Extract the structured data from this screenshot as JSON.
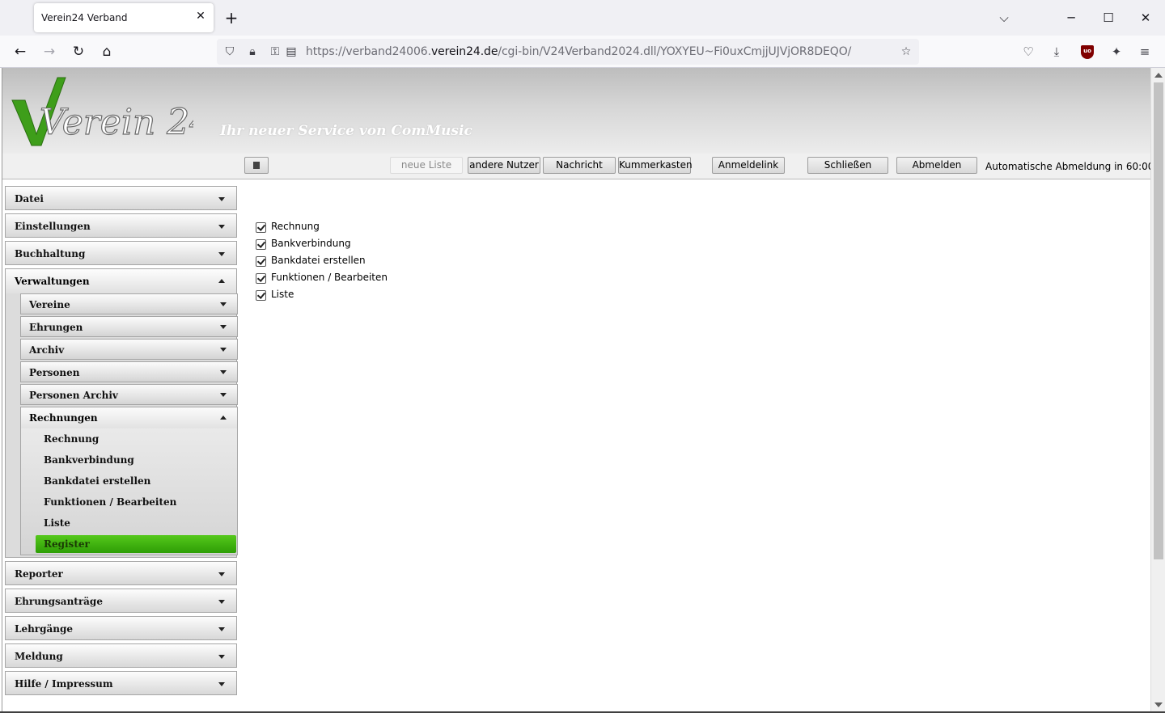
{
  "browser": {
    "tab_title": "Verein24 Verband",
    "url_prefix": "https://verband24006.",
    "url_domain": "verein24.de",
    "url_suffix": "/cgi-bin/V24Verband2024.dll/YOXYEU~Fi0uxCmjjUJVjOR8DEQO/"
  },
  "header": {
    "logo_text": "Verein 24",
    "tagline": "Ihr neuer Service von ComMusic"
  },
  "toolbar": {
    "neue_liste": "neue Liste",
    "andere_nutzer": "andere Nutzer",
    "nachricht": "Nachricht",
    "kummerkasten": "Kummerkasten",
    "anmeldelink": "Anmeldelink",
    "schliessen": "Schließen",
    "abmelden": "Abmelden",
    "auto_logout": "Automatische Abmeldung in 60:00"
  },
  "sidebar": {
    "datei": "Datei",
    "einstellungen": "Einstellungen",
    "buchhaltung": "Buchhaltung",
    "verwaltungen": "Verwaltungen",
    "vereine": "Vereine",
    "ehrungen": "Ehrungen",
    "archiv": "Archiv",
    "personen": "Personen",
    "personen_archiv": "Personen Archiv",
    "rechnungen": "Rechnungen",
    "rechnungen_items": [
      "Rechnung",
      "Bankverbindung",
      "Bankdatei erstellen",
      "Funktionen / Bearbeiten",
      "Liste",
      "Register"
    ],
    "reporter": "Reporter",
    "ehrungsantraege": "Ehrungsanträge",
    "lehrgaenge": "Lehrgänge",
    "meldung": "Meldung",
    "hilfe": "Hilfe / Impressum"
  },
  "content": {
    "checkboxes": [
      "Rechnung",
      "Bankverbindung",
      "Bankdatei erstellen",
      "Funktionen / Bearbeiten",
      "Liste"
    ]
  },
  "colors": {
    "active_green": "#3fb010",
    "logo_green": "#3e9e1a"
  }
}
